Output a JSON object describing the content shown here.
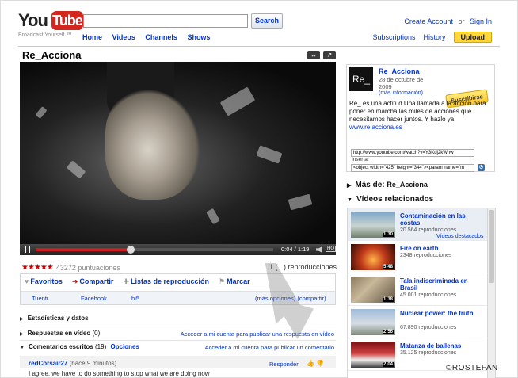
{
  "header": {
    "logo_you": "You",
    "logo_tube": "Tube",
    "logo_tagline": "Broadcast Yourself ™",
    "search_value": "",
    "search_button": "Search",
    "nav": [
      "Home",
      "Videos",
      "Channels",
      "Shows"
    ],
    "create_account": "Create Account",
    "or": "or",
    "sign_in": "Sign In",
    "subscriptions": "Subscriptions",
    "history": "History",
    "upload": "Upload"
  },
  "video": {
    "title": "Re_Acciona",
    "time": "0:04 / 1:19",
    "progress_fraction": 0.4,
    "hq_label": "HQ",
    "rating_stars": "★★★★★",
    "rating_count": "43272 puntuaciones",
    "views": "1 (...) reproducciones",
    "actions": [
      {
        "icon": "heart-icon",
        "glyph": "♥",
        "label": "Favoritos"
      },
      {
        "icon": "arrow-right-icon",
        "glyph": "➔",
        "label": "Compartir"
      },
      {
        "icon": "plus-icon",
        "glyph": "✚",
        "label": "Listas de reproducción"
      },
      {
        "icon": "flag-icon",
        "glyph": "⚑",
        "label": "Marcar"
      }
    ],
    "share_links": [
      "Tuenti",
      "Facebook",
      "hi5",
      "(más opciones) (compartir)"
    ]
  },
  "sections": {
    "stats": "Estadísticas y datos",
    "video_responses": "Respuestas en vídeo",
    "video_responses_count": "(0)",
    "video_responses_link": "Acceder a mi cuenta para publicar una respuesta en vídeo",
    "comments": "Comentarios escritos",
    "comments_count": "(19)",
    "comments_options": "Opciones",
    "comments_link": "Acceder a mi cuenta para publicar un comentario"
  },
  "comment": {
    "user": "redCorsair27",
    "ago": "(hace 9 minutos)",
    "reply": "Responder",
    "text": "I agree, we have to do something to stop what we are doing now"
  },
  "channel": {
    "thumb": "Re_",
    "name": "Re_Acciona",
    "date": "28 de octubre de 2009",
    "more_info": "(más información)",
    "subscribe": "Suscribirse",
    "description": "Re_ es una actitud Una llamada a la acción para poner en marcha las miles de acciones que necesitamos hacer juntos. Y hazlo ya.",
    "site": "www.re.acciona.es",
    "url": "http://www.youtube.com/watch?v=Y3Kdj2kWhw",
    "insertar_label": "Insertar",
    "embed": "<object width=\"425\" height=\"344\"><param name=\"m"
  },
  "sidebar": {
    "more_from_label": "Más de:",
    "more_from_name": "Re_Acciona",
    "related_label": "Vídeos relacionados",
    "related": [
      {
        "title": "Contaminación en las costas",
        "views": "20.564 reproducciones",
        "extra": "Vídeos destacados",
        "duration": "1:30"
      },
      {
        "title": "Fire on earth",
        "views": "2348 reproducciones",
        "extra": "",
        "duration": "5:48"
      },
      {
        "title": "Tala indiscriminada en Brasil",
        "views": "45.001 reproducciones",
        "extra": "",
        "duration": "1:38"
      },
      {
        "title": "Nuclear power: the truth",
        "views": "67.890 reproducciones",
        "extra": "",
        "duration": "2:56"
      },
      {
        "title": "Matanza de ballenas",
        "views": "35.125 reproducciones",
        "extra": "",
        "duration": "2:04"
      }
    ]
  },
  "watermark": "©ROSTEFAN",
  "colors": {
    "accent": "#0033cc",
    "brand": "#d3261d",
    "progress": "#cc1e1e",
    "upload": "#ffd73b"
  }
}
